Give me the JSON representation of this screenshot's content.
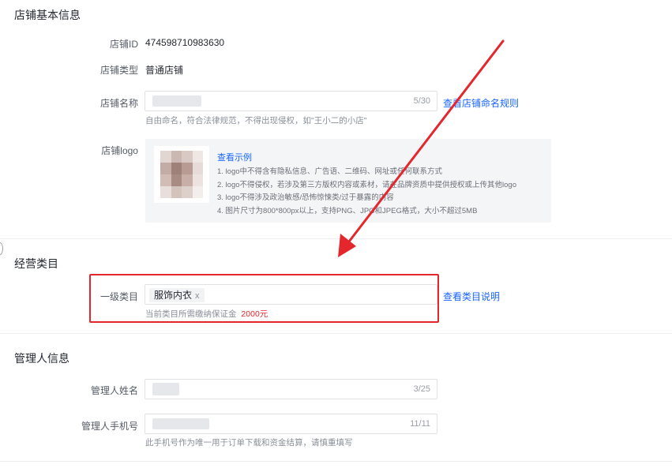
{
  "sections": {
    "basic": {
      "title": "店铺基本信息",
      "shop_id": {
        "label": "店铺ID",
        "value": "474598710983630"
      },
      "shop_type": {
        "label": "店铺类型",
        "value": "普通店铺"
      },
      "shop_name": {
        "label": "店铺名称",
        "counter": "5/30",
        "rule_link": "查看店铺命名规则",
        "hint": "自由命名，符合法律规范，不得出现侵权，如\"王小二的小店\""
      },
      "shop_logo": {
        "label": "店铺logo",
        "example_link": "查看示例",
        "requirements": [
          "1. logo中不得含有隐私信息、广告语、二维码、网址或任何联系方式",
          "2. logo不得侵权，若涉及第三方版权内容或素材，请在品牌资质中提供授权或上传其他logo",
          "3. logo不得涉及政治敏感/恐怖惊悚类/过于暴露的内容",
          "4. 图片尺寸为800*800px以上，支持PNG、JPG和JPEG格式，大小不超过5MB"
        ]
      }
    },
    "category": {
      "title": "经营类目",
      "primary": {
        "label": "一级类目",
        "tag": "服饰内衣",
        "tag_remove": "x",
        "info_link": "查看类目说明",
        "deposit_hint": "当前类目所需缴纳保证金",
        "deposit_amount": "2000元"
      }
    },
    "manager": {
      "title": "管理人信息",
      "name": {
        "label": "管理人姓名",
        "counter": "3/25"
      },
      "phone": {
        "label": "管理人手机号",
        "counter": "11/11",
        "hint": "此手机号作为唯一用于订单下载和资金结算，请慎重填写"
      }
    }
  },
  "colors": {
    "accent": "#1966ff",
    "annotation_red": "#e4262d",
    "deposit_red": "#e4262d"
  },
  "icons": {
    "remove_tag": "close-icon",
    "annotation": "red-arrow-icon"
  }
}
